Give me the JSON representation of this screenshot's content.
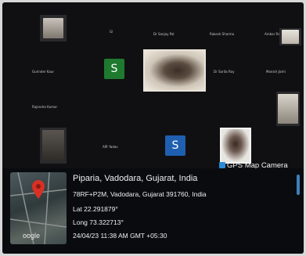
{
  "call": {
    "participant_names": [
      "Dr Sanjay Pal",
      "Rakesh Sharma",
      "Ambar Rai",
      "Gurinder Kaur",
      "Dr Sarita Roy",
      "Manish Joshi",
      "Rajendra Kumar",
      "AIR Yadav"
    ],
    "avatar_letter": "S",
    "avatar_colors": {
      "green": "#1e7a2e",
      "blue": "#1f5fb0"
    }
  },
  "gps_overlay": {
    "app_label": "GPS Map Camera",
    "map_logo": "oogle",
    "place": "Piparia, Vadodara, Gujarat, India",
    "address": "78RF+P2M, Vadodara, Gujarat 391760, India",
    "latitude": "Lat 22.291879°",
    "longitude": "Long 73.322713°",
    "timestamp": "24/04/23 11:38 AM GMT +05:30",
    "pin_color": "#d93025",
    "badge_color": "#2b8bd6"
  }
}
